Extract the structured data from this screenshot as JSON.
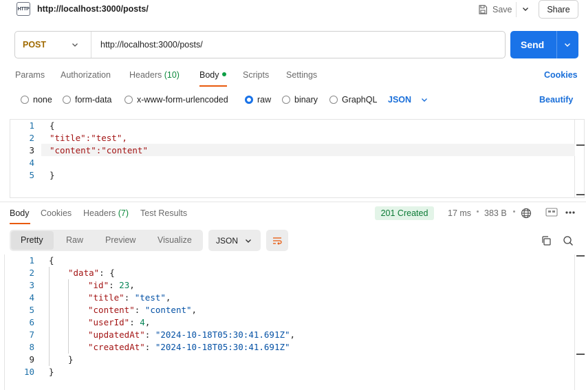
{
  "request": {
    "title": "http://localhost:3000/posts/",
    "icon_text": "HTTP",
    "save_label": "Save",
    "share_label": "Share",
    "method": "POST",
    "url": "http://localhost:3000/posts/",
    "send_label": "Send"
  },
  "request_tabs": [
    {
      "label": "Params"
    },
    {
      "label": "Authorization"
    },
    {
      "label": "Headers",
      "count": "(10)"
    },
    {
      "label": "Body"
    },
    {
      "label": "Scripts"
    },
    {
      "label": "Settings"
    }
  ],
  "cookies_label": "Cookies",
  "body_types": [
    {
      "label": "none",
      "selected": false
    },
    {
      "label": "form-data",
      "selected": false
    },
    {
      "label": "x-www-form-urlencoded",
      "selected": false
    },
    {
      "label": "raw",
      "selected": true
    },
    {
      "label": "binary",
      "selected": false
    },
    {
      "label": "GraphQL",
      "selected": false
    }
  ],
  "body_format": "JSON",
  "beautify_label": "Beautify",
  "request_body": {
    "line_numbers": [
      "1",
      "2",
      "3",
      "4",
      "5"
    ],
    "lines": [
      "{",
      "\"title\":\"test\",",
      "\"content\":\"content\"",
      "",
      "}"
    ]
  },
  "response_tabs": [
    {
      "label": "Body"
    },
    {
      "label": "Cookies"
    },
    {
      "label": "Headers",
      "count": "(7)"
    },
    {
      "label": "Test Results"
    }
  ],
  "response_status": "201 Created",
  "response_time": "17 ms",
  "response_size": "383 B",
  "view_modes": [
    "Pretty",
    "Raw",
    "Preview",
    "Visualize"
  ],
  "response_format": "JSON",
  "response_body": {
    "line_numbers": [
      "1",
      "2",
      "3",
      "4",
      "5",
      "6",
      "7",
      "8",
      "9",
      "10"
    ],
    "open_brace": "{",
    "data_key": "\"data\"",
    "id_key": "\"id\"",
    "id_value": "23",
    "title_key": "\"title\"",
    "title_value": "\"test\"",
    "content_key": "\"content\"",
    "content_value": "\"content\"",
    "userId_key": "\"userId\"",
    "userId_value": "4",
    "updatedAt_key": "\"updatedAt\"",
    "updatedAt_value": "\"2024-10-18T05:30:41.691Z\"",
    "createdAt_key": "\"createdAt\"",
    "createdAt_value": "\"2024-10-18T05:30:41.691Z\"",
    "inner_close": "}",
    "outer_close": "}"
  },
  "colors": {
    "send_button": "#1a73e8",
    "method": "#a06a00",
    "tab_underline": "#e8590c",
    "status_badge_bg": "#e3f4e8",
    "status_badge_text": "#0b7a35",
    "link": "#1a6fd9"
  },
  "icons": [
    "http-file-icon",
    "save-icon",
    "chevron-down-icon",
    "globe-icon",
    "response-save-icon",
    "more-icon",
    "wrap-lines-icon",
    "copy-icon",
    "search-icon"
  ]
}
